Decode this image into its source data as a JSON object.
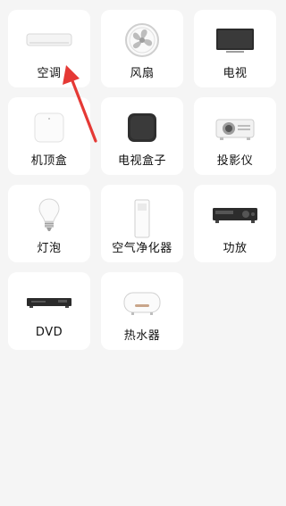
{
  "devices": [
    {
      "label": "空调",
      "icon": "air-conditioner-icon"
    },
    {
      "label": "风扇",
      "icon": "fan-icon"
    },
    {
      "label": "电视",
      "icon": "tv-icon"
    },
    {
      "label": "机顶盒",
      "icon": "set-top-box-icon"
    },
    {
      "label": "电视盒子",
      "icon": "tv-box-icon"
    },
    {
      "label": "投影仪",
      "icon": "projector-icon"
    },
    {
      "label": "灯泡",
      "icon": "light-bulb-icon"
    },
    {
      "label": "空气净化器",
      "icon": "air-purifier-icon"
    },
    {
      "label": "功放",
      "icon": "amplifier-icon"
    },
    {
      "label": "DVD",
      "icon": "dvd-player-icon"
    },
    {
      "label": "热水器",
      "icon": "water-heater-icon"
    }
  ],
  "annotation": {
    "icon": "red-arrow-icon",
    "color": "#e53935"
  }
}
